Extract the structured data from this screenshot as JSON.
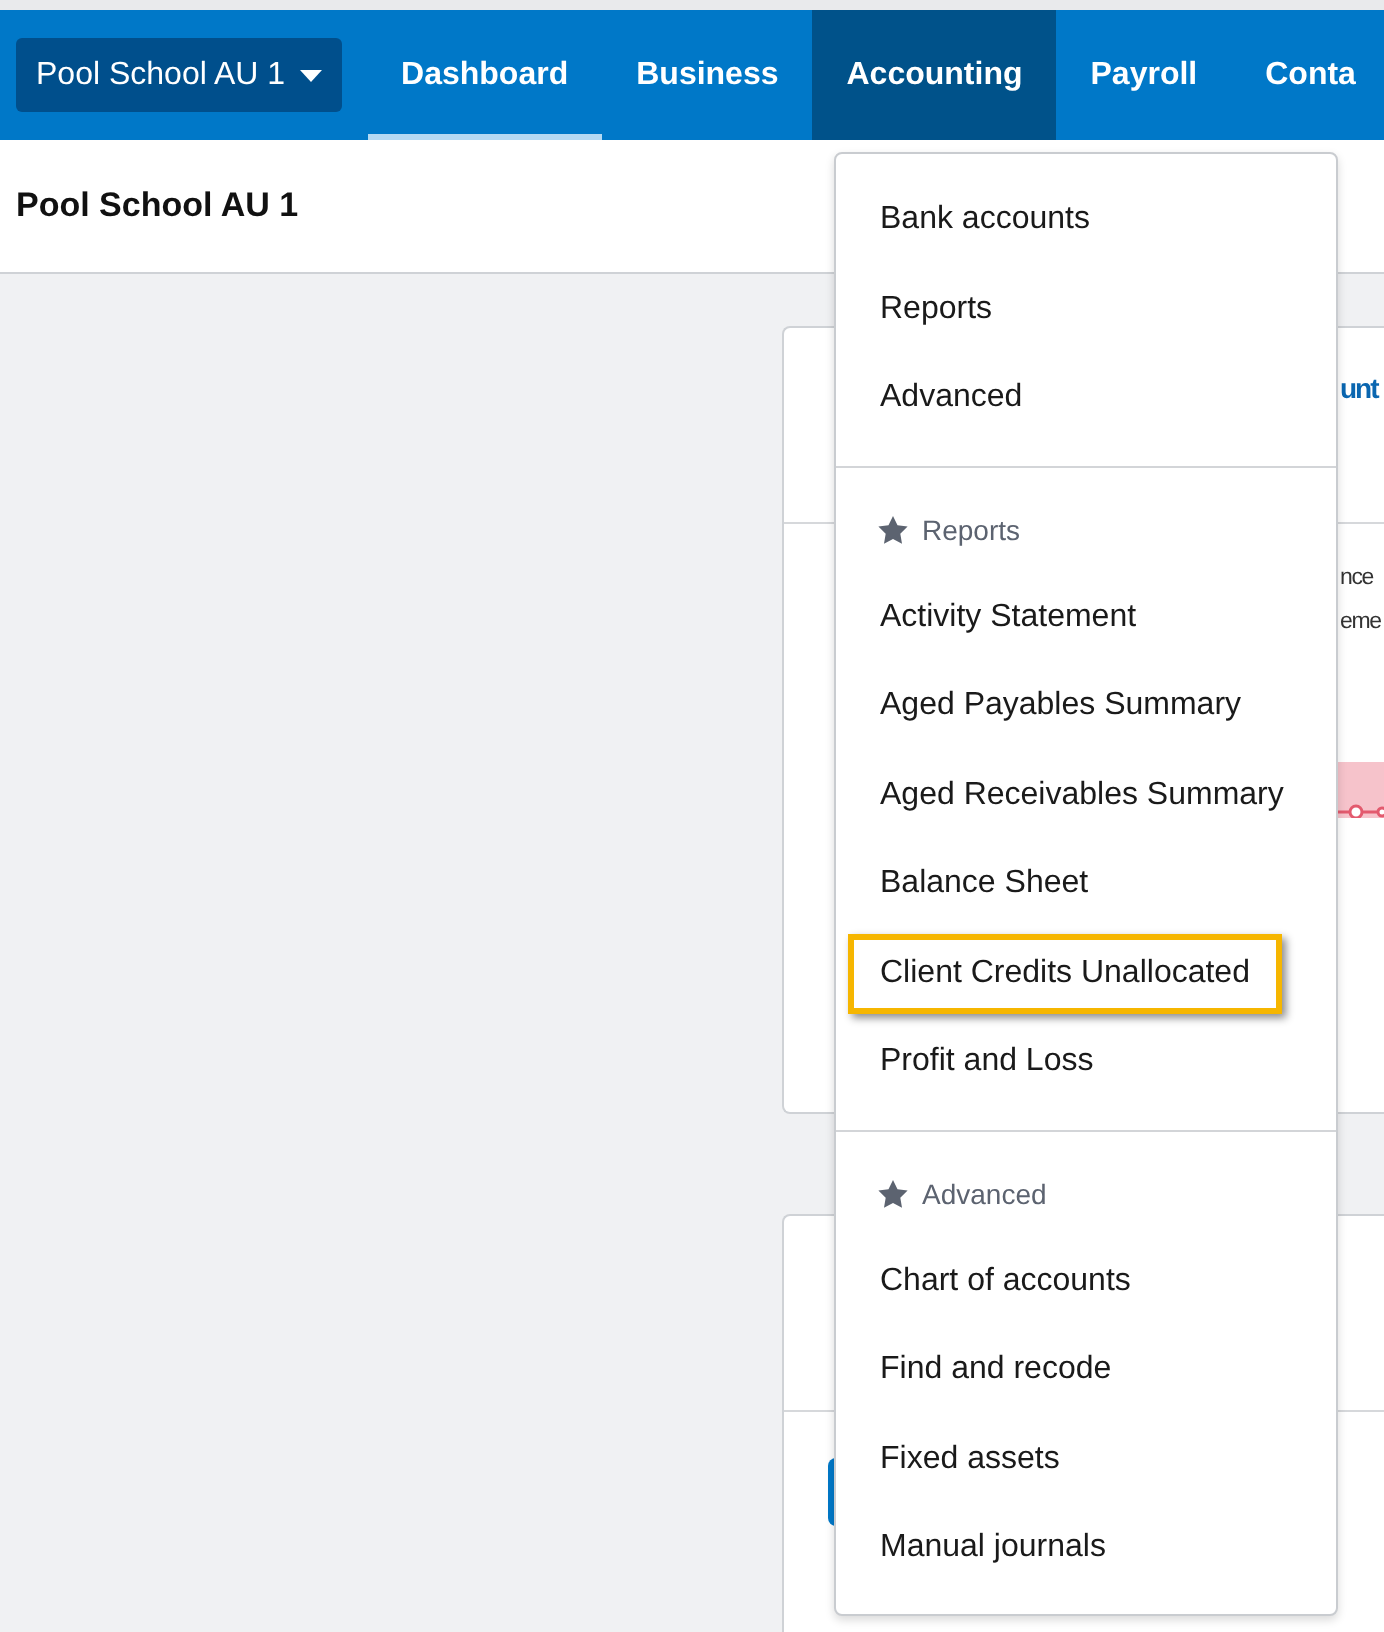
{
  "company_switcher": {
    "label": "Pool School AU 1"
  },
  "nav_tabs": [
    {
      "label": "Dashboard",
      "selected": true,
      "expanded": false
    },
    {
      "label": "Business",
      "selected": false,
      "expanded": false
    },
    {
      "label": "Accounting",
      "selected": false,
      "expanded": true
    },
    {
      "label": "Payroll",
      "selected": false,
      "expanded": false
    },
    {
      "label": "Conta",
      "selected": false,
      "expanded": false
    }
  ],
  "page_title": "Pool School AU 1",
  "background_cards": [
    {
      "title_fragment": "unt",
      "text_fragments": [
        "nce",
        "eme"
      ],
      "has_chart": true
    },
    {
      "has_button": true
    }
  ],
  "accounting_menu": {
    "sections": [
      {
        "items": [
          {
            "label": "Bank accounts",
            "highlighted": false
          },
          {
            "label": "Reports",
            "highlighted": false
          },
          {
            "label": "Advanced",
            "highlighted": false
          }
        ]
      },
      {
        "heading": "Reports",
        "items": [
          {
            "label": "Activity Statement",
            "highlighted": false
          },
          {
            "label": "Aged Payables Summary",
            "highlighted": false
          },
          {
            "label": "Aged Receivables Summary",
            "highlighted": false
          },
          {
            "label": "Balance Sheet",
            "highlighted": false
          },
          {
            "label": "Client Credits Unallocated",
            "highlighted": true
          },
          {
            "label": "Profit and Loss",
            "highlighted": false
          }
        ]
      },
      {
        "heading": "Advanced",
        "items": [
          {
            "label": "Chart of accounts",
            "highlighted": false
          },
          {
            "label": "Find and recode",
            "highlighted": false
          },
          {
            "label": "Fixed assets",
            "highlighted": false
          },
          {
            "label": "Manual journals",
            "highlighted": false
          }
        ]
      }
    ]
  }
}
